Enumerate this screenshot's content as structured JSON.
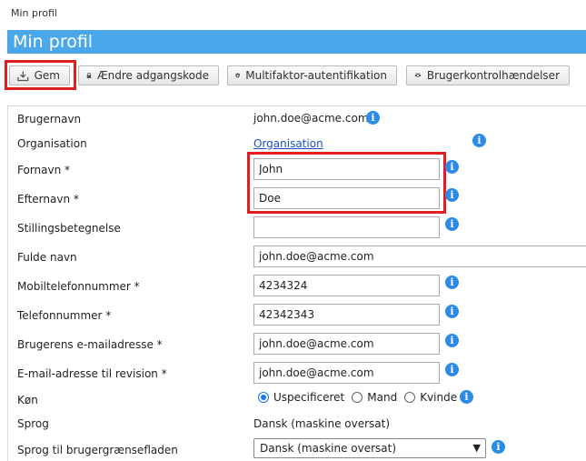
{
  "breadcrumb": "Min profil",
  "page_title": "Min profil",
  "toolbar": {
    "save": "Gem",
    "change_password": "Ændre adgangskode",
    "mfa": "Multifaktor-autentifikation",
    "audit": "Brugerkontrolhændelser"
  },
  "form": {
    "username_label": "Brugernavn",
    "username_value": "john.doe@acme.com",
    "organisation_label": "Organisation",
    "organisation_link": "Organisation",
    "firstname_label": "Fornavn *",
    "firstname_value": "John",
    "lastname_label": "Efternavn *",
    "lastname_value": "Doe",
    "jobtitle_label": "Stillingsbetegnelse",
    "jobtitle_value": "",
    "fullname_label": "Fulde navn",
    "fullname_value": "john.doe@acme.com",
    "mobile_label": "Mobiltelefonnummer *",
    "mobile_value": "4234324",
    "phone_label": "Telefonnummer *",
    "phone_value": "42342343",
    "email_label": "Brugerens e-mailadresse *",
    "email_value": "john.doe@acme.com",
    "audit_email_label": "E-mail-adresse til revision *",
    "audit_email_value": "john.doe@acme.com",
    "gender_label": "Køn",
    "gender_options": [
      "Uspecificeret",
      "Mand",
      "Kvinde"
    ],
    "gender_selected": "Uspecificeret",
    "language_label": "Sprog",
    "language_value": "Dansk (maskine oversat)",
    "ui_language_label": "Sprog til brugergrænsefladen",
    "ui_language_value": "Dansk (maskine oversat)"
  },
  "icons": {
    "info": "info-icon",
    "save": "download-icon",
    "password": "lock-icon",
    "mfa": "shield-lock-icon",
    "audit": "eye-icon"
  },
  "colors": {
    "title_bar": "#4aa8ea",
    "info_icon": "#2d8be8",
    "highlight": "#e02020",
    "link": "#1a4fc8"
  }
}
